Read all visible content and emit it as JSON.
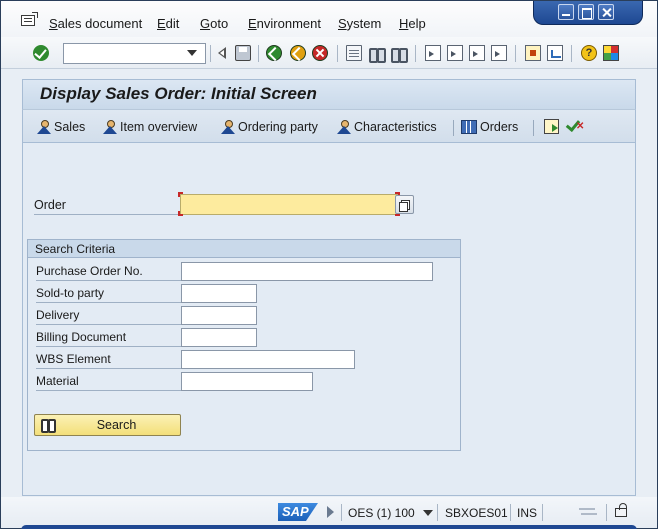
{
  "menu": {
    "items": [
      "Sales document",
      "Edit",
      "Goto",
      "Environment",
      "System",
      "Help"
    ]
  },
  "toolbar": {
    "command_value": ""
  },
  "header": {
    "title": "Display Sales Order: Initial Screen"
  },
  "app_toolbar": {
    "sales_label": "Sales",
    "item_overview_label": "Item overview",
    "ordering_party_label": "Ordering party",
    "characteristics_label": "Characteristics",
    "orders_label": "Orders"
  },
  "form": {
    "order_label": "Order",
    "order_value": ""
  },
  "search_criteria": {
    "title": "Search Criteria",
    "fields": [
      {
        "label": "Purchase Order No.",
        "value": ""
      },
      {
        "label": "Sold-to party",
        "value": ""
      },
      {
        "label": "Delivery",
        "value": ""
      },
      {
        "label": "Billing Document",
        "value": ""
      },
      {
        "label": "WBS Element",
        "value": ""
      },
      {
        "label": "Material",
        "value": ""
      }
    ],
    "search_button_label": "Search"
  },
  "status_bar": {
    "logo_text": "SAP",
    "system": "OES (1) 100",
    "server": "SBXOES01",
    "mode": "INS"
  },
  "colors": {
    "required_field": "#fdeb9e",
    "title_bar": "#c9d9ea",
    "work_area": "#e3ebf4",
    "window_frame": "#1e4892"
  }
}
